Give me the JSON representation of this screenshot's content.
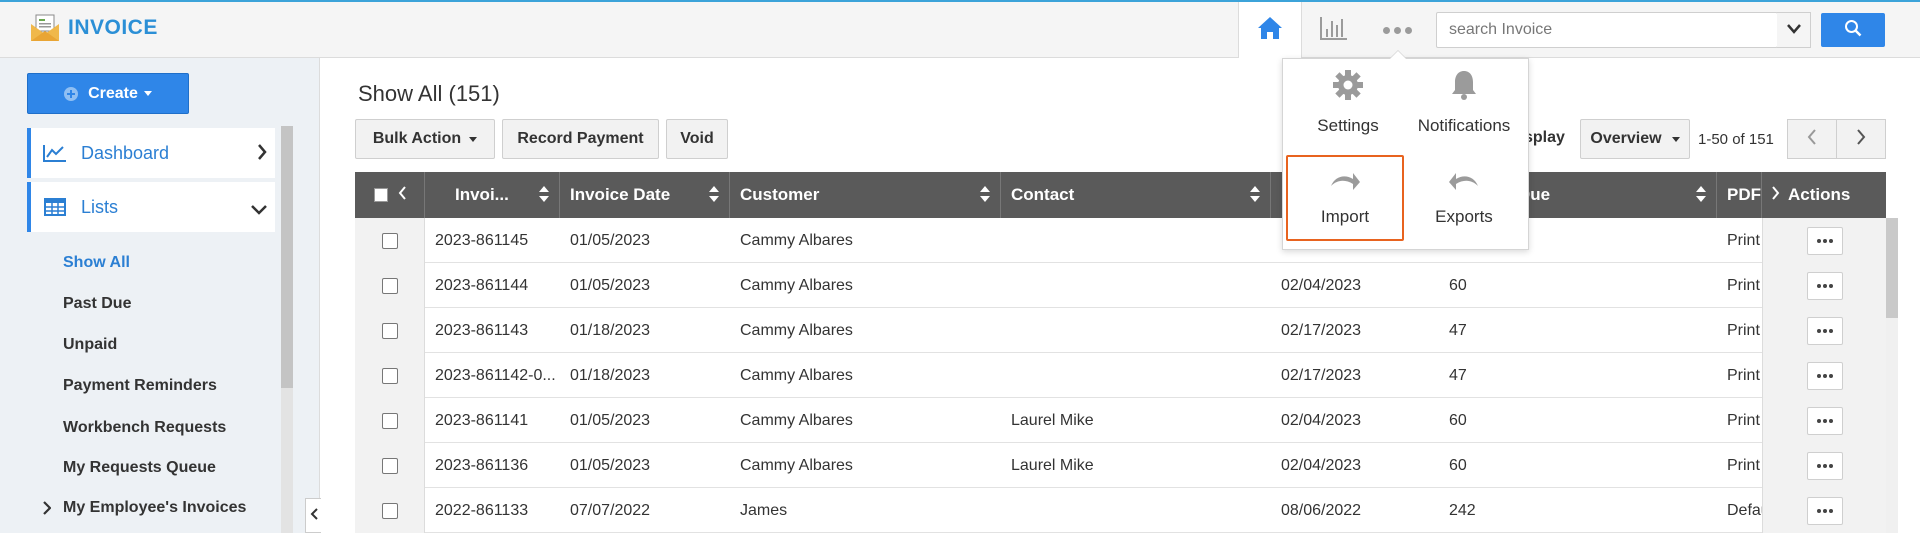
{
  "app": {
    "title": "INVOICE"
  },
  "search": {
    "placeholder": "search Invoice"
  },
  "colors": {
    "accent": "#2f86e8",
    "highlight": "#e8631f",
    "header": "#5a5a5a"
  },
  "sidebar": {
    "create_label": "Create",
    "sections": [
      {
        "label": "Dashboard",
        "icon": "line-chart-icon"
      },
      {
        "label": "Lists",
        "icon": "list-table-icon"
      }
    ],
    "items": [
      "Show All",
      "Past Due",
      "Unpaid",
      "Payment Reminders",
      "Workbench Requests",
      "My Requests Queue",
      "My Employee's Invoices"
    ]
  },
  "main": {
    "title": "Show All (151)",
    "toolbar": {
      "bulk_action": "Bulk Action",
      "record_payment": "Record Payment",
      "void": "Void"
    },
    "display": {
      "label": "Display",
      "selected": "Overview"
    },
    "paging": "1-50 of 151"
  },
  "popover": {
    "settings": "Settings",
    "notifications": "Notifications",
    "import": "Import",
    "exports": "Exports"
  },
  "table": {
    "headers": {
      "invoice": "Invoi...",
      "invoice_date": "Invoice Date",
      "customer": "Customer",
      "contact": "Contact",
      "due_date": "",
      "amount_due": "Amount Due",
      "pdf": "PDF",
      "actions": "Actions"
    },
    "rows": [
      {
        "invoice": "2023-861145",
        "date": "01/05/2023",
        "customer": "Cammy Albares",
        "contact": "",
        "due": "",
        "days": "",
        "pdf": "Print"
      },
      {
        "invoice": "2023-861144",
        "date": "01/05/2023",
        "customer": "Cammy Albares",
        "contact": "",
        "due": "02/04/2023",
        "days": "60",
        "pdf": "Print"
      },
      {
        "invoice": "2023-861143",
        "date": "01/18/2023",
        "customer": "Cammy Albares",
        "contact": "",
        "due": "02/17/2023",
        "days": "47",
        "pdf": "Print"
      },
      {
        "invoice": "2023-861142-0...",
        "date": "01/18/2023",
        "customer": "Cammy Albares",
        "contact": "",
        "due": "02/17/2023",
        "days": "47",
        "pdf": "Print"
      },
      {
        "invoice": "2023-861141",
        "date": "01/05/2023",
        "customer": "Cammy Albares",
        "contact": "Laurel Mike",
        "due": "02/04/2023",
        "days": "60",
        "pdf": "Print"
      },
      {
        "invoice": "2023-861136",
        "date": "01/05/2023",
        "customer": "Cammy Albares",
        "contact": "Laurel Mike",
        "due": "02/04/2023",
        "days": "60",
        "pdf": "Print"
      },
      {
        "invoice": "2022-861133",
        "date": "07/07/2022",
        "customer": "James",
        "contact": "",
        "due": "08/06/2022",
        "days": "242",
        "pdf": "Defau"
      }
    ]
  }
}
